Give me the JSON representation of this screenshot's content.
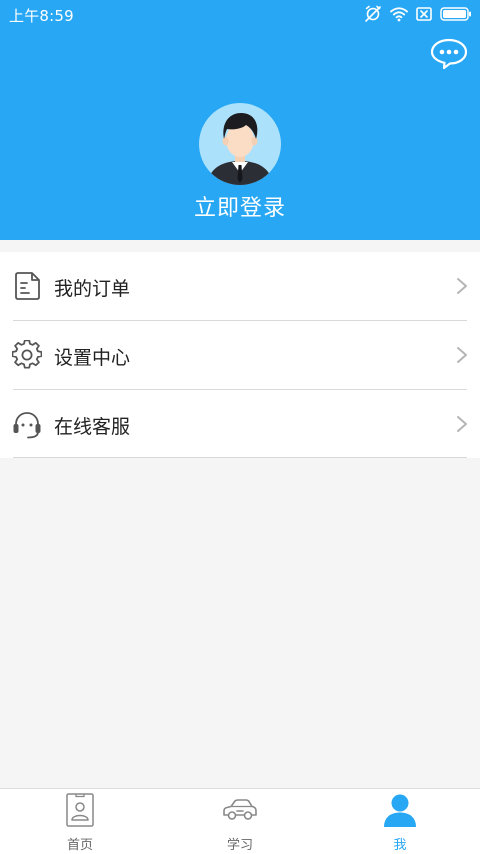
{
  "status_bar": {
    "time": "上午8:59"
  },
  "profile": {
    "login_label": "立即登录"
  },
  "menu": {
    "items": [
      {
        "label": "我的订单",
        "icon": "order-icon"
      },
      {
        "label": "设置中心",
        "icon": "gear-icon"
      },
      {
        "label": "在线客服",
        "icon": "headset-icon"
      }
    ]
  },
  "tabs": [
    {
      "label": "首页",
      "icon": "home-badge-icon",
      "active": false
    },
    {
      "label": "学习",
      "icon": "car-icon",
      "active": false
    },
    {
      "label": "我",
      "icon": "person-icon",
      "active": true
    }
  ],
  "colors": {
    "primary": "#27a7f4",
    "avatar_bg": "#ace1fb",
    "background": "#f5f5f5"
  }
}
